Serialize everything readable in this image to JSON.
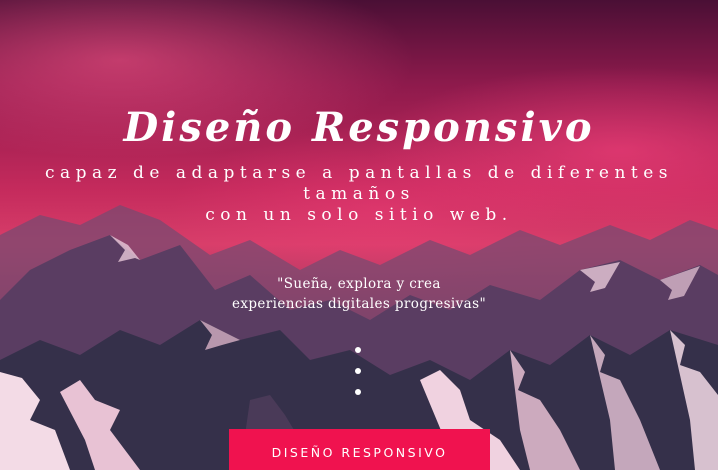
{
  "hero": {
    "title": "Diseño Responsivo",
    "subtitle_lines": [
      "capaz de adaptarse a pantallas de diferentes",
      "tamaños",
      "con un solo sitio web."
    ],
    "quote_lines": [
      "\"Sueña, explora y crea",
      "experiencias digitales progresivas\""
    ],
    "scroll_dots_count": 3,
    "cta_label": "DISEÑO RESPONSIVO",
    "cta_color": "#f0124f",
    "background_image": "pink-sky-snowy-mountains"
  }
}
